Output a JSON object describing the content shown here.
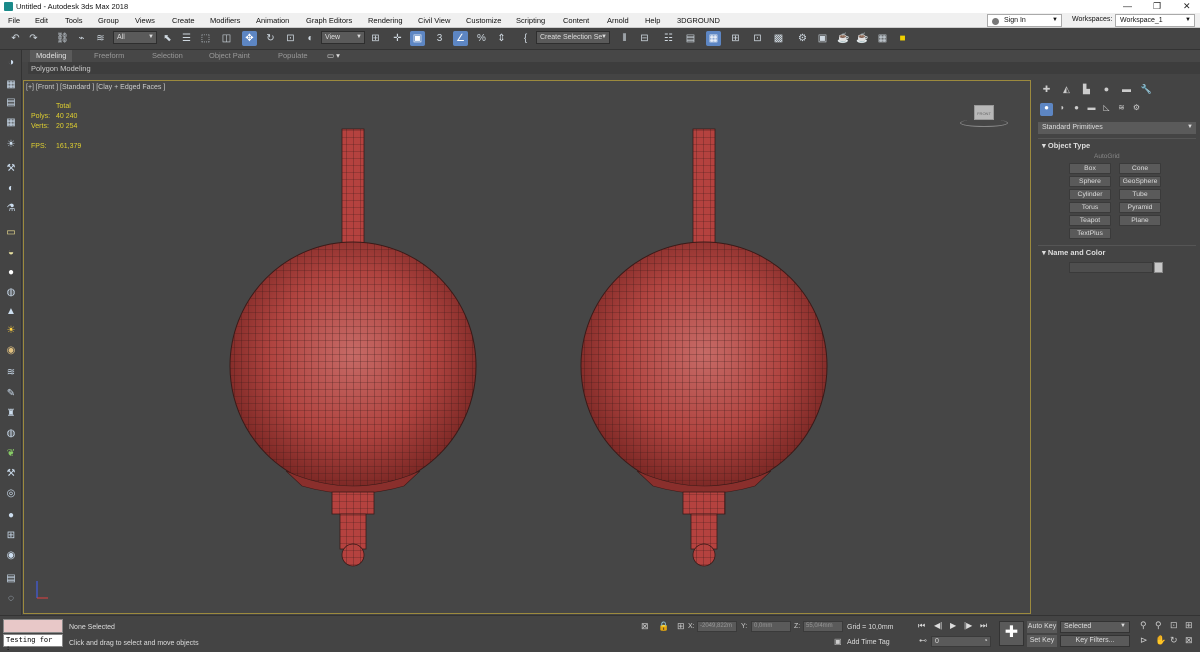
{
  "window": {
    "title": "Untitled - Autodesk 3ds Max 2018",
    "controls": [
      "—",
      "❐",
      "✕"
    ]
  },
  "menu": [
    "File",
    "Edit",
    "Tools",
    "Group",
    "Views",
    "Create",
    "Modifiers",
    "Animation",
    "Graph Editors",
    "Rendering",
    "Civil View",
    "Customize",
    "Scripting",
    "Content",
    "Arnold",
    "Help",
    "3DGROUND"
  ],
  "account": {
    "sign_in": "Sign In",
    "workspaces_label": "Workspaces:",
    "workspace": "Workspace_1"
  },
  "toolbar": {
    "selection_filter": "All",
    "ref_coord": "View",
    "named_selection": "Create Selection Se"
  },
  "ribbon": {
    "tabs": [
      "Modeling",
      "Freeform",
      "Selection",
      "Object Paint",
      "Populate"
    ],
    "active_tab": "Modeling",
    "sub_label": "Polygon Modeling"
  },
  "viewport": {
    "label": "[+] [Front ] [Standard ] [Clay + Edged Faces ]",
    "stats": {
      "total_label": "Total",
      "polys_label": "Polys:",
      "polys": "40 240",
      "verts_label": "Verts:",
      "verts": "20 254",
      "fps_label": "FPS:",
      "fps": "161,379"
    },
    "viewcube_label": "FRONT",
    "mesh_color": "#b5423f",
    "wire_color": "#3a1a18"
  },
  "command_panel": {
    "category": "Standard Primitives",
    "object_type_title": "Object Type",
    "autogrid": "AutoGrid",
    "buttons": [
      "Box",
      "Cone",
      "Sphere",
      "GeoSphere",
      "Cylinder",
      "Tube",
      "Torus",
      "Pyramid",
      "Teapot",
      "Plane",
      "TextPlus"
    ],
    "name_color_title": "Name and Color"
  },
  "status": {
    "maxscript": "Testing for :",
    "selection": "None Selected",
    "prompt": "Click and drag to select and move objects",
    "x_label": "X:",
    "x_value": "-2049,822m",
    "y_label": "Y:",
    "y_value": "0,0mm",
    "z_label": "Z:",
    "z_value": "55,0/4mm",
    "grid": "Grid = 10,0mm",
    "add_time_tag": "Add Time Tag",
    "frame": "0",
    "auto_key": "Auto Key",
    "set_key": "Set Key",
    "selected": "Selected",
    "key_filters": "Key Filters..."
  }
}
